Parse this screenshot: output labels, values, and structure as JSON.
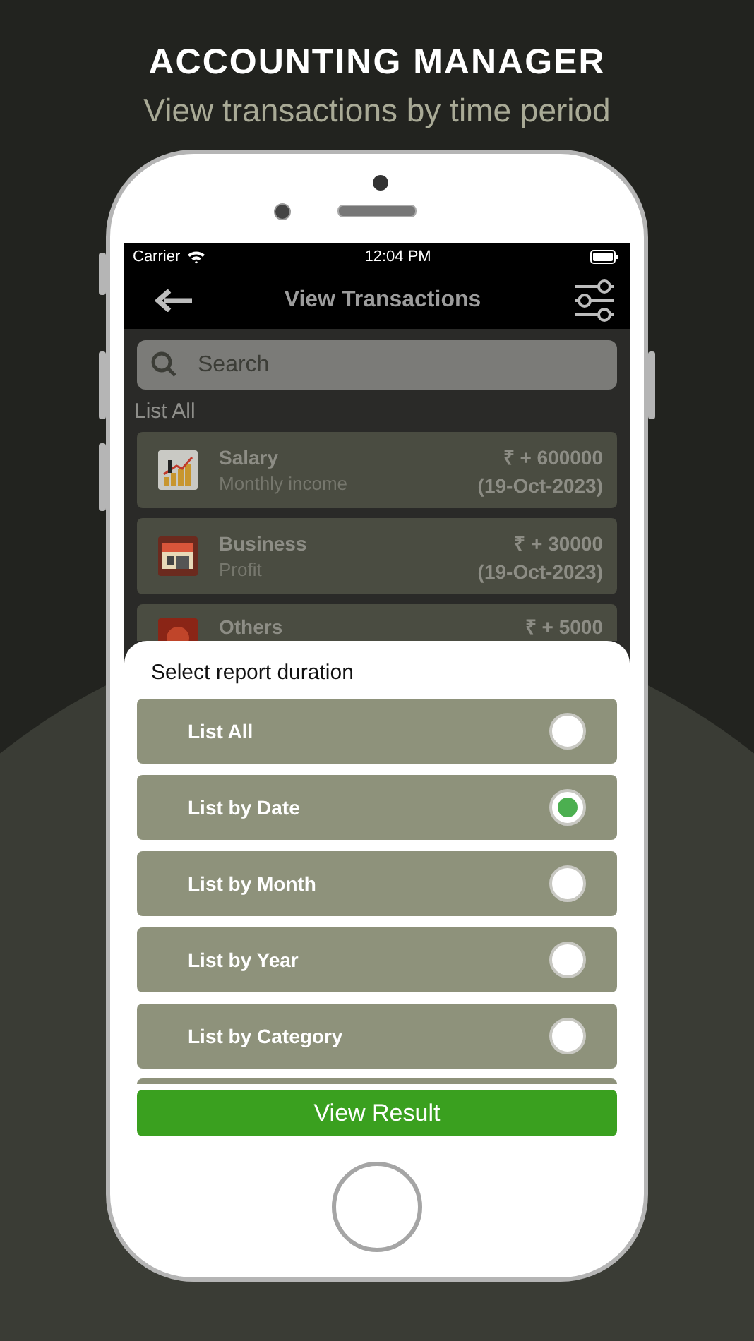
{
  "header": {
    "title": "ACCOUNTING MANAGER",
    "subtitle": "View transactions by time period"
  },
  "status_bar": {
    "carrier": "Carrier",
    "time": "12:04 PM"
  },
  "nav": {
    "title": "View Transactions"
  },
  "search": {
    "placeholder": "Search"
  },
  "list_label": "List All",
  "transactions": [
    {
      "kind": "salary",
      "name": "Salary",
      "note": "Monthly income",
      "amount": "₹ + 600000",
      "date": "(19-Oct-2023)"
    },
    {
      "kind": "shop",
      "name": "Business",
      "note": "Profit",
      "amount": "₹ + 30000",
      "date": "(19-Oct-2023)"
    },
    {
      "kind": "other",
      "name": "Others",
      "amount": "₹ + 5000"
    }
  ],
  "sheet": {
    "title": "Select report duration",
    "options": [
      {
        "label": "List All",
        "selected": false
      },
      {
        "label": "List by Date",
        "selected": true
      },
      {
        "label": "List by Month",
        "selected": false
      },
      {
        "label": "List by Year",
        "selected": false
      },
      {
        "label": "List by Category",
        "selected": false
      }
    ],
    "button": "View Result"
  }
}
